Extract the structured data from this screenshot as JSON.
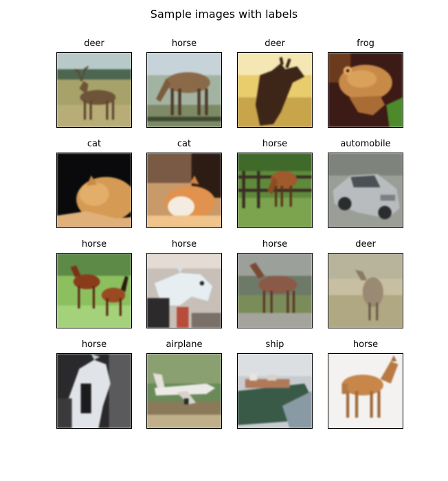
{
  "figure": {
    "title": "Sample images with labels",
    "images": [
      {
        "label": "deer",
        "scene": "deer-field"
      },
      {
        "label": "horse",
        "scene": "horse-grazing"
      },
      {
        "label": "deer",
        "scene": "moose-yellow"
      },
      {
        "label": "frog",
        "scene": "frog"
      },
      {
        "label": "cat",
        "scene": "cat-dark"
      },
      {
        "label": "cat",
        "scene": "cat-sleeping"
      },
      {
        "label": "horse",
        "scene": "horse-fence"
      },
      {
        "label": "automobile",
        "scene": "car"
      },
      {
        "label": "horse",
        "scene": "horse-foal"
      },
      {
        "label": "horse",
        "scene": "horse-white-head"
      },
      {
        "label": "horse",
        "scene": "horse-brown-standing"
      },
      {
        "label": "deer",
        "scene": "deer-grass"
      },
      {
        "label": "horse",
        "scene": "horse-white-rider"
      },
      {
        "label": "airplane",
        "scene": "airplane"
      },
      {
        "label": "ship",
        "scene": "ship"
      },
      {
        "label": "horse",
        "scene": "horse-white-bg"
      }
    ]
  }
}
